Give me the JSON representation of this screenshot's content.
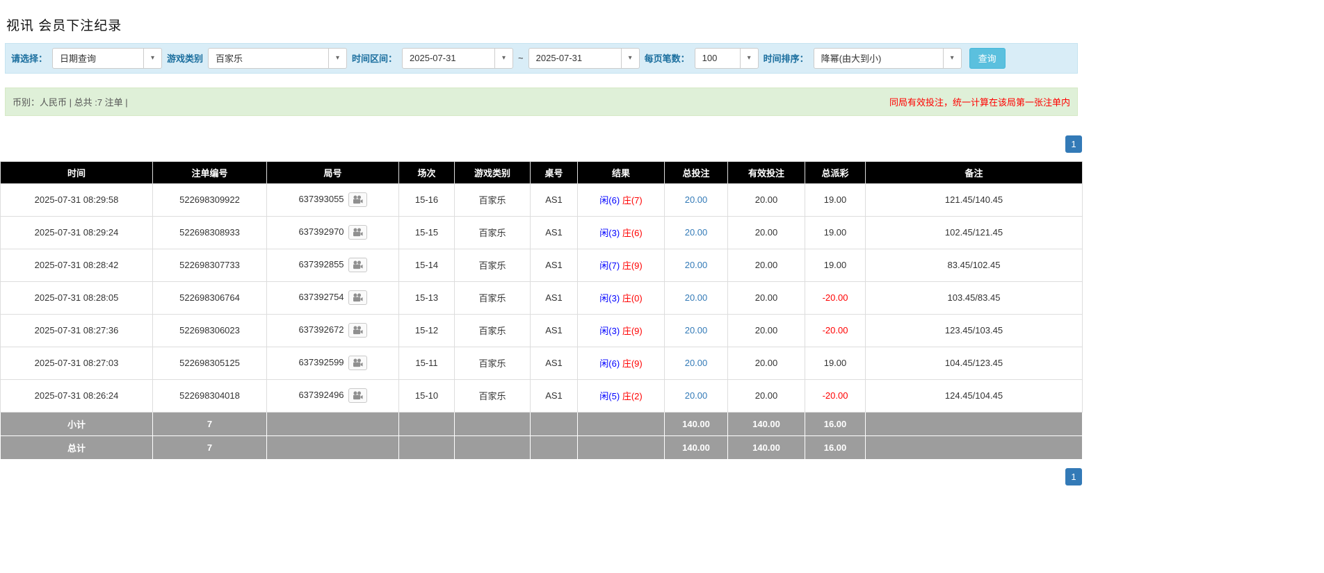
{
  "page": {
    "title": "视讯 会员下注纪录"
  },
  "icons": {
    "dropdown_caret": "▾"
  },
  "filters": {
    "date_mode": {
      "label": "请选择：",
      "value": "日期查询"
    },
    "game_type": {
      "label": "游戏类别",
      "value": "百家乐"
    },
    "date_range": {
      "label": "时间区间：",
      "from": "2025-07-31",
      "separator": "~",
      "to": "2025-07-31"
    },
    "page_size": {
      "label": "每页笔数：",
      "value": "100"
    },
    "sort_order": {
      "label": "时间排序：",
      "value": "降幂(由大到小)"
    },
    "search_button": "查询"
  },
  "summary": {
    "left": "币别：人民币 | 总共 :7 注单 |",
    "right": "同局有效投注，统一计算在该局第一张注单内"
  },
  "pagination": {
    "page": "1"
  },
  "table": {
    "headers": [
      "时间",
      "注单编号",
      "局号",
      "场次",
      "游戏类别",
      "桌号",
      "结果",
      "总投注",
      "有效投注",
      "总派彩",
      "备注"
    ],
    "rows": [
      {
        "time": "2025-07-31 08:29:58",
        "bet_id": "522698309922",
        "round": "637393055",
        "session": "15-16",
        "game": "百家乐",
        "table_no": "AS1",
        "result_player": "闲(6)",
        "result_banker": "庄(7)",
        "total_bet": "20.00",
        "valid_bet": "20.00",
        "payout": "19.00",
        "note": "121.45/140.45"
      },
      {
        "time": "2025-07-31 08:29:24",
        "bet_id": "522698308933",
        "round": "637392970",
        "session": "15-15",
        "game": "百家乐",
        "table_no": "AS1",
        "result_player": "闲(3)",
        "result_banker": "庄(6)",
        "total_bet": "20.00",
        "valid_bet": "20.00",
        "payout": "19.00",
        "note": "102.45/121.45"
      },
      {
        "time": "2025-07-31 08:28:42",
        "bet_id": "522698307733",
        "round": "637392855",
        "session": "15-14",
        "game": "百家乐",
        "table_no": "AS1",
        "result_player": "闲(7)",
        "result_banker": "庄(9)",
        "total_bet": "20.00",
        "valid_bet": "20.00",
        "payout": "19.00",
        "note": "83.45/102.45"
      },
      {
        "time": "2025-07-31 08:28:05",
        "bet_id": "522698306764",
        "round": "637392754",
        "session": "15-13",
        "game": "百家乐",
        "table_no": "AS1",
        "result_player": "闲(3)",
        "result_banker": "庄(0)",
        "total_bet": "20.00",
        "valid_bet": "20.00",
        "payout": "-20.00",
        "note": "103.45/83.45"
      },
      {
        "time": "2025-07-31 08:27:36",
        "bet_id": "522698306023",
        "round": "637392672",
        "session": "15-12",
        "game": "百家乐",
        "table_no": "AS1",
        "result_player": "闲(3)",
        "result_banker": "庄(9)",
        "total_bet": "20.00",
        "valid_bet": "20.00",
        "payout": "-20.00",
        "note": "123.45/103.45"
      },
      {
        "time": "2025-07-31 08:27:03",
        "bet_id": "522698305125",
        "round": "637392599",
        "session": "15-11",
        "game": "百家乐",
        "table_no": "AS1",
        "result_player": "闲(6)",
        "result_banker": "庄(9)",
        "total_bet": "20.00",
        "valid_bet": "20.00",
        "payout": "19.00",
        "note": "104.45/123.45"
      },
      {
        "time": "2025-07-31 08:26:24",
        "bet_id": "522698304018",
        "round": "637392496",
        "session": "15-10",
        "game": "百家乐",
        "table_no": "AS1",
        "result_player": "闲(5)",
        "result_banker": "庄(2)",
        "total_bet": "20.00",
        "valid_bet": "20.00",
        "payout": "-20.00",
        "note": "124.45/104.45"
      }
    ],
    "footer_rows": [
      {
        "label": "小计",
        "count": "7",
        "total_bet": "140.00",
        "valid_bet": "140.00",
        "payout": "16.00"
      },
      {
        "label": "总计",
        "count": "7",
        "total_bet": "140.00",
        "valid_bet": "140.00",
        "payout": "16.00"
      }
    ]
  }
}
